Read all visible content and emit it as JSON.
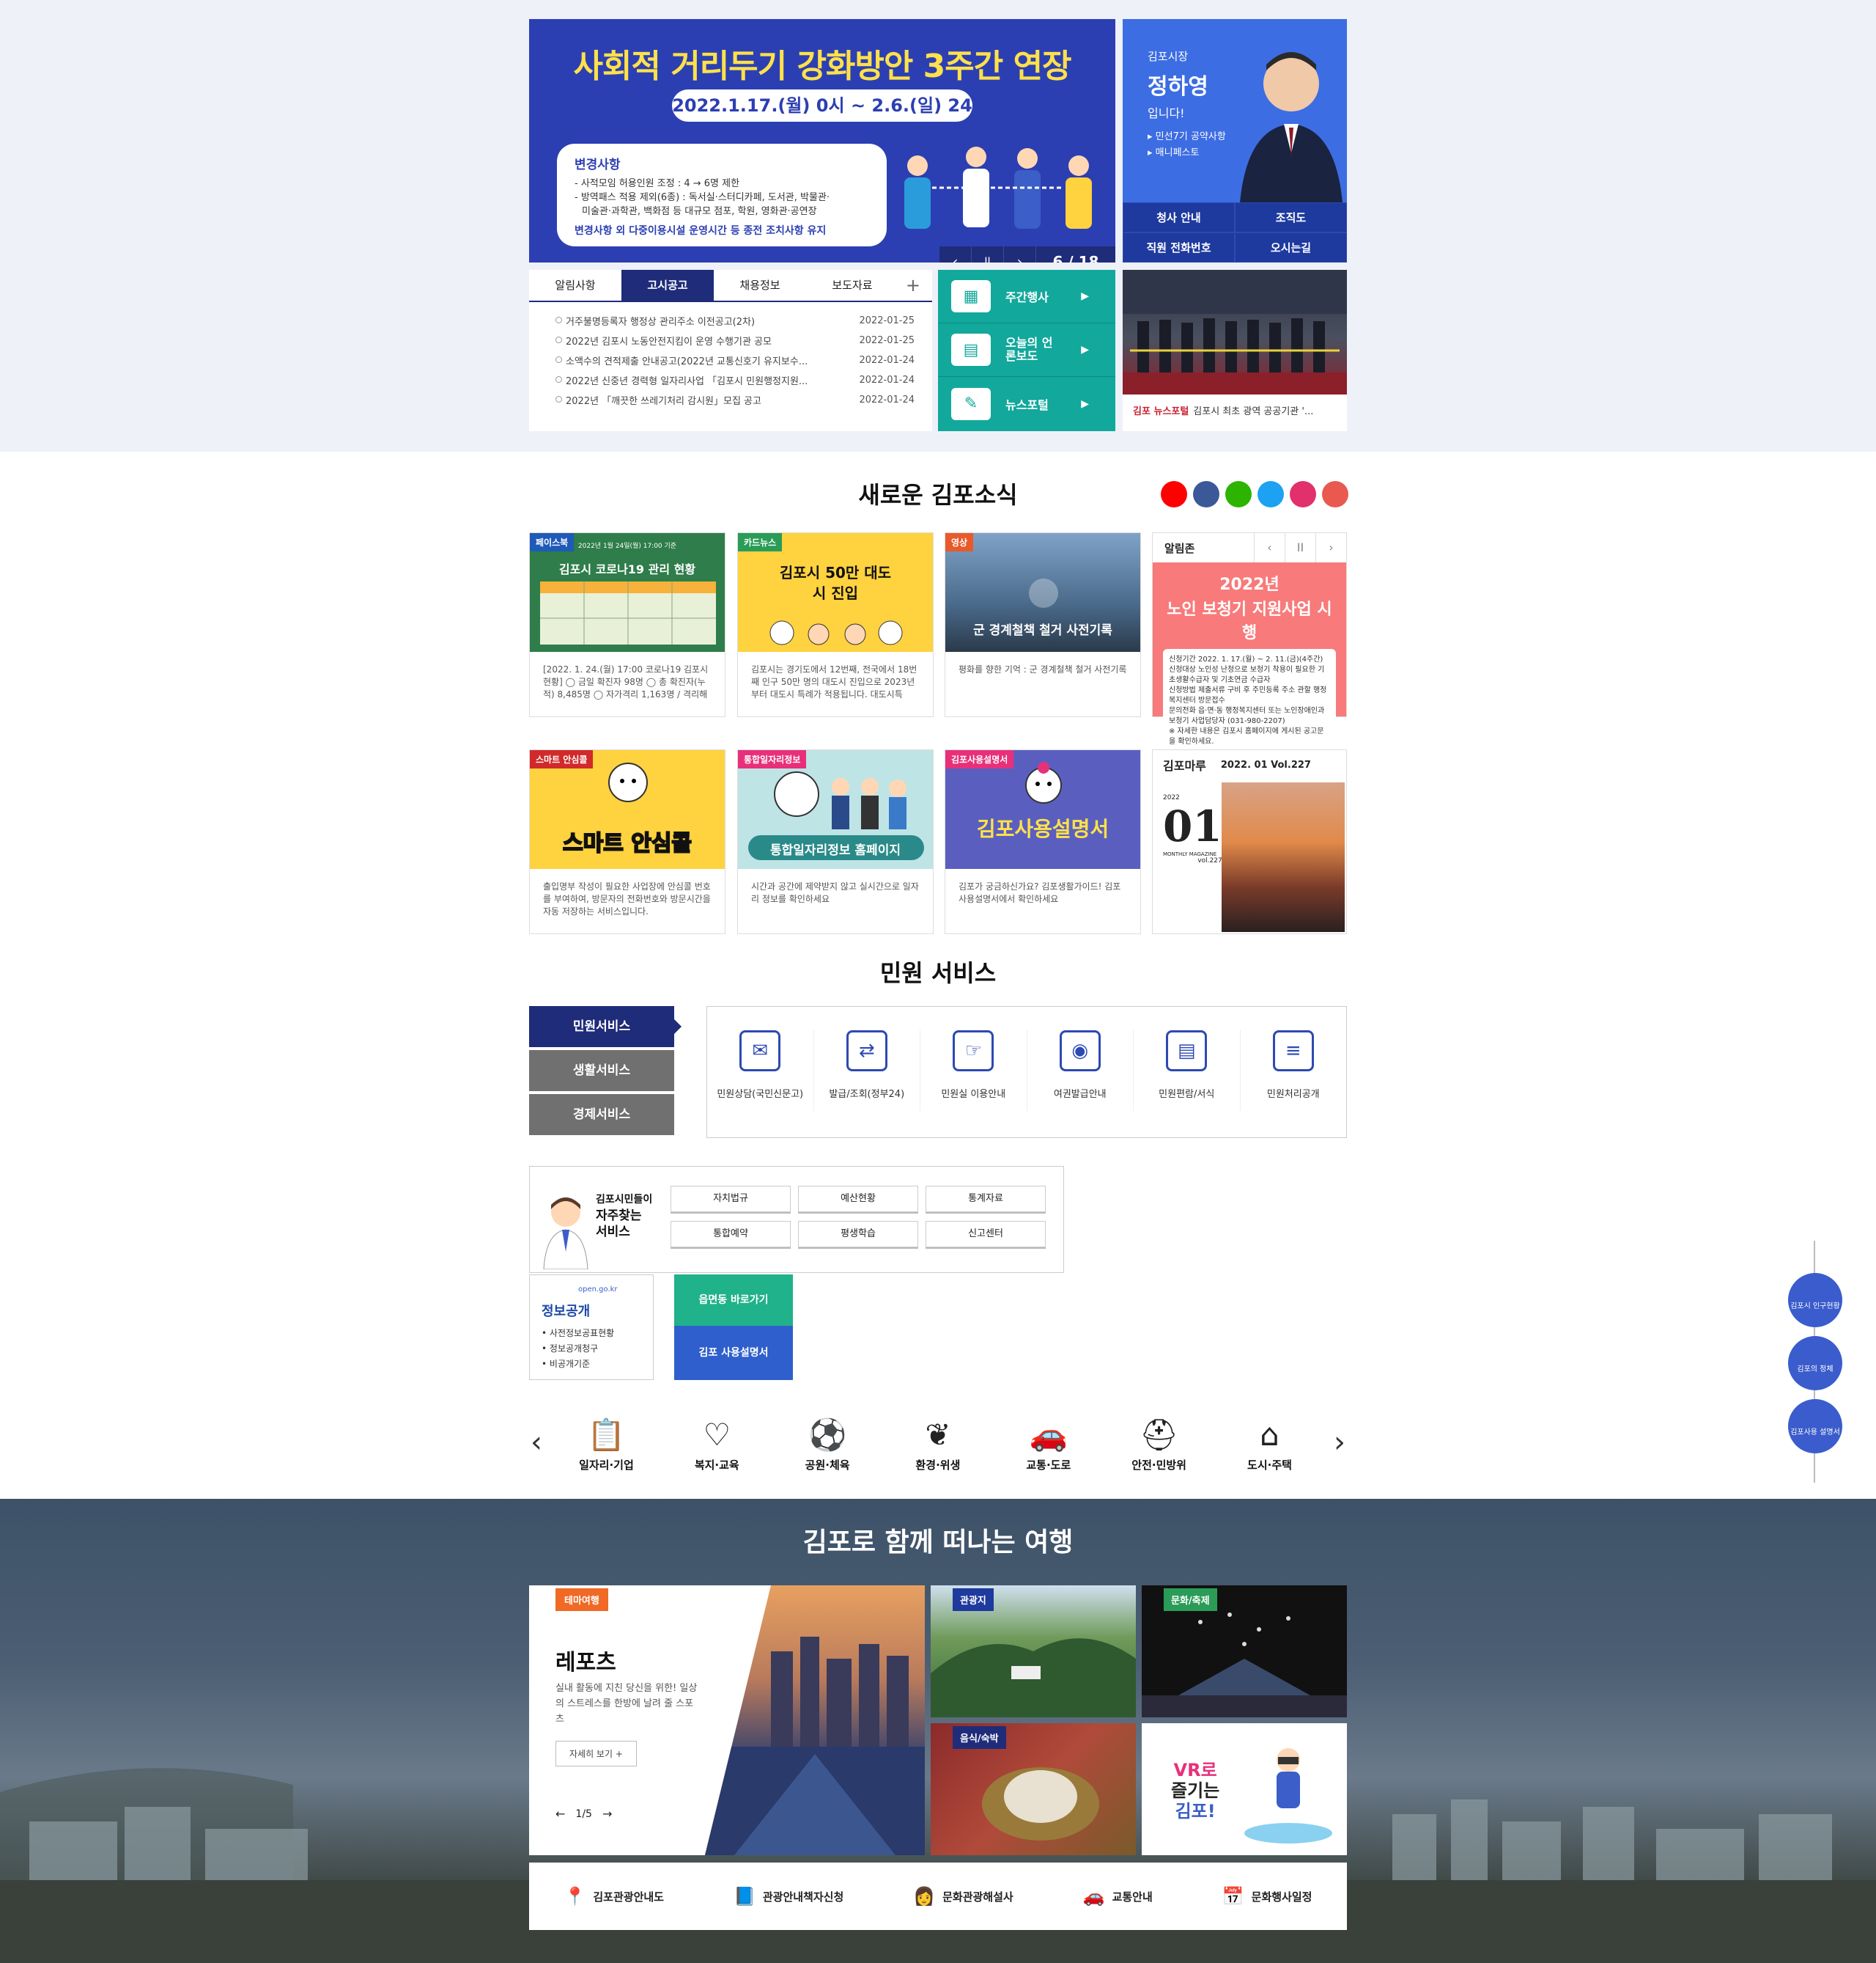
{
  "banner": {
    "title": "사회적 거리두기 강화방안 3주간 연장",
    "date": "2022.1.17.(월) 0시 ~ 2.6.(일) 24시",
    "box_title": "변경사항",
    "line1": "- 사적모임 허용인원 조정 : 4 → 6명 제한",
    "line2": "- 방역패스 적용 제외(6종) : 독서실·스터디카페, 도서관, 박물관·",
    "line3": "미술관·과학관, 백화점 등 대규모 점포, 학원, 영화관·공연장",
    "bottom": "변경사항 외 다중이용시설 운영시간 등 종전 조치사항 유지",
    "prev": "‹",
    "pause": "II",
    "next": "›",
    "counter": "6 / 18"
  },
  "mayor": {
    "line1": "김포시장",
    "name": "정하영",
    "line3": "입니다!",
    "link1": "▸ 민선7기 공약사항",
    "link2": "▸ 매니페스토",
    "grid": [
      "청사 안내",
      "조직도",
      "직원 전화번호",
      "오시는길"
    ]
  },
  "notice": {
    "tabs": [
      "알림사항",
      "고시공고",
      "채용정보",
      "보도자료"
    ],
    "active_tab": 1,
    "plus": "+",
    "rows": [
      {
        "title": "거주불명등록자 행정상 관리주소 이전공고(2차)",
        "date": "2022-01-25"
      },
      {
        "title": "2022년 김포시 노동안전지킴이 운영 수행기관 공모",
        "date": "2022-01-25"
      },
      {
        "title": "소액수의 견적제출 안내공고(2022년 교통신호기 유지보수...",
        "date": "2022-01-24"
      },
      {
        "title": "2022년 신중년 경력형 일자리사업 「김포시 민원행정지원...",
        "date": "2022-01-24"
      },
      {
        "title": "2022년 「깨끗한 쓰레기처리 감시원」모집 공고",
        "date": "2022-01-24"
      }
    ]
  },
  "quick": {
    "items": [
      {
        "label": "주간행사",
        "icon": "calendar-icon"
      },
      {
        "label": "오늘의 언론보도",
        "icon": "newspaper-icon"
      },
      {
        "label": "뉴스포털",
        "icon": "news-icon"
      }
    ],
    "arrow": "▶"
  },
  "press": {
    "logo": "김포 뉴스포털",
    "caption": "김포시 최초 광역 공공기관 '..."
  },
  "news": {
    "title": "새로운 김포소식",
    "sns": [
      {
        "name": "youtube-icon",
        "color": "#ff0000"
      },
      {
        "name": "facebook-icon",
        "color": "#3b5998"
      },
      {
        "name": "blog-icon",
        "color": "#2db400"
      },
      {
        "name": "twitter-icon",
        "color": "#1da1f2"
      },
      {
        "name": "instagram-icon",
        "color": "#e1306c"
      },
      {
        "name": "instagram2-icon",
        "color": "#e95950"
      }
    ],
    "cards": [
      {
        "tag": "페이스북",
        "tag_color": "#1e5ab8",
        "head": "2022년 1월 24일(월) 17:00 기준",
        "big": "김포시 코로나19 관리 현황",
        "desc": "[2022. 1. 24.(월) 17:00 코로나19 김포시 현황] ◯ 금일 확진자 98명 ◯ 총 확진자(누적) 8,485명 ◯ 자가격리 1,163명 / 격리해"
      },
      {
        "tag": "카드뉴스",
        "tag_color": "#2a9c58",
        "head": "",
        "big": "김포시 50만 대도시 진입",
        "desc": "김포시는 경기도에서 12번째, 전국에서 18번째 인구 50만 명의 대도시 진입으로 2023년부터 대도시 특례가 적용됩니다. 대도시특"
      },
      {
        "tag": "영상",
        "tag_color": "#e85a2a",
        "head": "",
        "big": "군 경계철책 철거 사전기록",
        "desc": "평화를 향한 기억 : 군 경계철책 철거 사전기록"
      },
      {
        "tag": "스마트 안심콜",
        "tag_color": "#d12a2a",
        "head": "",
        "big": "스마트 안심콜",
        "desc": "출입명부 작성이 필요한 사업장에 안심콜 번호를 부여하여, 방문자의 전화번호와 방문시간을 자동 저장하는 서비스입니다."
      },
      {
        "tag": "통합일자리정보",
        "tag_color": "#e8307a",
        "head": "",
        "big": "통합일자리정보 홈페이지",
        "desc": "시간과 공간에 제약받지 않고 실시간으로 일자리 정보를 확인하세요"
      },
      {
        "tag": "김포사용설명서",
        "tag_color": "#e8307a",
        "head": "",
        "big": "김포사용설명서",
        "desc": "김포가 궁금하신가요? 김포생활가이드! 김포사용설명서에서 확인하세요"
      }
    ],
    "alarm": {
      "label": "알림존",
      "prev": "‹",
      "pause": "II",
      "next": "›",
      "year": "2022년",
      "title": "노인 보청기 지원사업 시행",
      "detail1": "신청기간 2022. 1. 17.(월) ~ 2. 11.(금)(4주간)",
      "detail2": "신청대상 노인성 난청으로 보청기 착용이 필요한 기초생활수급자 및 기초연금 수급자",
      "detail3": "신청방법 제출서류 구비 후 주민등록 주소 관할 행정복지센터 방문접수",
      "detail4": "문의전화 읍·면·동 행정복지센터 또는 노인장애인과 보청기 사업담당자 (031-980-2207)",
      "detail5": "※ 자세한 내용은 김포시 홈페이지에 게시된 공고문을 확인하세요."
    },
    "magazine": {
      "label": "김포마루",
      "issue": "2022. 01   Vol.227",
      "year": "2022",
      "month": "01",
      "sub": "MONTHLY MAGAZINE",
      "vol": "vol.227"
    }
  },
  "civil": {
    "title": "민원 서비스",
    "menu": [
      "민원서비스",
      "생활서비스",
      "경제서비스"
    ],
    "items": [
      {
        "label": "민원상담(국민신문고)",
        "icon": "chat-icon",
        "glyph": "✉"
      },
      {
        "label": "발급/조회(정부24)",
        "icon": "document-exchange-icon",
        "glyph": "⇄"
      },
      {
        "label": "민원실 이용안내",
        "icon": "hand-document-icon",
        "glyph": "☞"
      },
      {
        "label": "여권발급안내",
        "icon": "passport-icon",
        "glyph": "◉"
      },
      {
        "label": "민원편람/서식",
        "icon": "book-icon",
        "glyph": "▤"
      },
      {
        "label": "민원처리공개",
        "icon": "list-document-icon",
        "glyph": "≡"
      }
    ]
  },
  "frequent": {
    "title_lines": [
      "김포시민들이",
      "자주찾는",
      "서비스"
    ],
    "buttons": [
      "자치법규",
      "예산현황",
      "통계자료",
      "통합예약",
      "평생학습",
      "신고센터"
    ]
  },
  "info_open": {
    "site": "open.go.kr",
    "title": "정보공개",
    "items": [
      "사전정보공표현황",
      "정보공개청구",
      "비공개기준"
    ]
  },
  "shortcuts": {
    "green": "읍면동 바로가기",
    "blue": "김포 사용설명서"
  },
  "categories": {
    "prev": "‹",
    "next": "›",
    "items": [
      {
        "label": "일자리·기업",
        "icon": "clipboard-icon",
        "glyph": "📋"
      },
      {
        "label": "복지·교육",
        "icon": "hand-heart-icon",
        "glyph": "♡"
      },
      {
        "label": "공원·체육",
        "icon": "ball-icon",
        "glyph": "⚽"
      },
      {
        "label": "환경·위생",
        "icon": "sprout-icon",
        "glyph": "❦"
      },
      {
        "label": "교통·도로",
        "icon": "car-icon",
        "glyph": "🚗"
      },
      {
        "label": "안전·민방위",
        "icon": "shield-plus-icon",
        "glyph": "⛑"
      },
      {
        "label": "도시·주택",
        "icon": "house-icon",
        "glyph": "⌂"
      }
    ]
  },
  "tour": {
    "title": "김포로 함께 떠나는 여행",
    "main_tag": "테마여행",
    "main_title": "레포츠",
    "main_desc": "실내 활동에 지친 당신을 위한! 일상의 스트레스를 한방에 날려 줄 스포츠",
    "more": "자세히 보기 +",
    "pager": "1/5",
    "pager_prev": "←",
    "pager_next": "→",
    "tiles": [
      {
        "tag": "관광지",
        "color": "#1e3a9e"
      },
      {
        "tag": "문화/축제",
        "color": "#2a9c58"
      },
      {
        "tag": "음식/숙박",
        "color": "#1f2c7a"
      }
    ],
    "vr": {
      "line1": "VR로",
      "line2": "즐기는",
      "line3": "김포!"
    },
    "bar": [
      {
        "label": "김포관광안내도",
        "icon": "map-pin-icon",
        "glyph": "📍"
      },
      {
        "label": "관광안내책자신청",
        "icon": "book-icon",
        "glyph": "📘"
      },
      {
        "label": "문화관광해설사",
        "icon": "guide-icon",
        "glyph": "👩"
      },
      {
        "label": "교통안내",
        "icon": "car-icon",
        "glyph": "🚗"
      },
      {
        "label": "문화행사일정",
        "icon": "calendar-icon",
        "glyph": "📅"
      }
    ]
  },
  "floating": {
    "items": [
      "김포시 인구현황",
      "김포의 정체",
      "김포사용 설명서"
    ]
  },
  "colors": {
    "navy": "#1f2c7a",
    "teal": "#12a89c",
    "banner_blue": "#2c3fb2",
    "banner_yellow": "#ffe14a"
  }
}
